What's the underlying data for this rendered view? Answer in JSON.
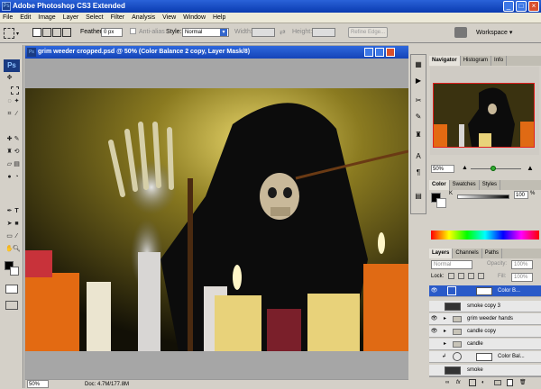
{
  "window": {
    "title": "Adobe Photoshop CS3 Extended",
    "icon": "ps-icon",
    "controls": [
      "_",
      "□",
      "×"
    ]
  },
  "menu": [
    "File",
    "Edit",
    "Image",
    "Layer",
    "Select",
    "Filter",
    "Analysis",
    "View",
    "Window",
    "Help"
  ],
  "options": {
    "feather_label": "Feather:",
    "feather_value": "0 px",
    "antialias_label": "Anti-alias",
    "style_label": "Style:",
    "style_value": "Normal",
    "width_label": "Width:",
    "height_label": "Height:",
    "refine_label": "Refine Edge...",
    "workspace_label": "Workspace ▾"
  },
  "tools": [
    "marquee",
    "move",
    "lasso",
    "magic-wand",
    "crop",
    "slice",
    "healing",
    "brush",
    "stamp",
    "history-brush",
    "eraser",
    "gradient",
    "dodge",
    "pen",
    "type",
    "path-select",
    "shape",
    "notes",
    "eyedropper",
    "hand",
    "zoom"
  ],
  "toolbar_logo": "Ps",
  "document": {
    "title": "grim weeder cropped.psd @ 50% (Color Balance 2 copy, Layer Mask/8)",
    "zoom": "50%",
    "doc_info": "Doc: 4.7M/177.8M"
  },
  "navigator": {
    "tabs": [
      "Navigator",
      "Histogram",
      "Info"
    ],
    "zoom": "50%"
  },
  "color": {
    "tabs": [
      "Color",
      "Swatches",
      "Styles"
    ],
    "channel_label": "K",
    "value": "100",
    "percent": "%"
  },
  "layers": {
    "tabs": [
      "Layers",
      "Channels",
      "Paths"
    ],
    "blend": "Normal",
    "opacity_label": "Opacity:",
    "opacity": "100%",
    "lock_label": "Lock:",
    "fill_label": "Fill:",
    "fill": "100%",
    "rows": [
      {
        "name": "Color B...",
        "selected": true
      },
      {
        "name": "smoke copy 3",
        "selected": false
      },
      {
        "name": "grim weeder hands",
        "selected": false
      },
      {
        "name": "candle copy",
        "selected": false
      },
      {
        "name": "candle",
        "selected": false
      },
      {
        "name": "Color Bal...",
        "selected": false
      },
      {
        "name": "smoke",
        "selected": false
      }
    ],
    "footer_icons": [
      "link-icon",
      "fx-icon",
      "mask-icon",
      "adjustment-icon",
      "folder-icon",
      "new-layer-icon",
      "trash-icon"
    ]
  }
}
